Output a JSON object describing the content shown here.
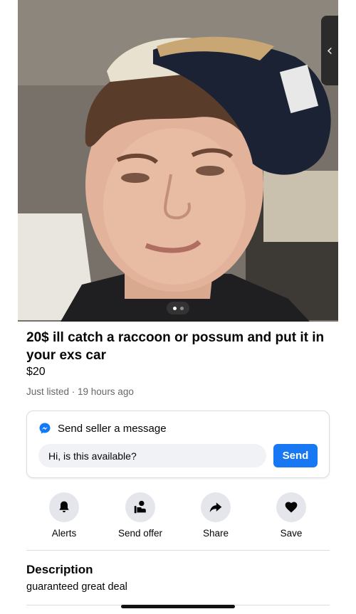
{
  "listing": {
    "title": "20$ ill catch a raccoon or possum and put it in your exs car",
    "price": "$20",
    "meta": "Just listed · 19 hours ago",
    "photo_count": 2,
    "active_photo": 1
  },
  "message": {
    "header": "Send seller a message",
    "input_value": "Hi, is this available?",
    "send_label": "Send"
  },
  "actions": [
    {
      "label": "Alerts",
      "icon": "bell-icon"
    },
    {
      "label": "Send offer",
      "icon": "offer-icon"
    },
    {
      "label": "Share",
      "icon": "share-icon"
    },
    {
      "label": "Save",
      "icon": "heart-icon"
    }
  ],
  "description": {
    "title": "Description",
    "text": "guaranteed great deal"
  },
  "colors": {
    "accent": "#1877f2",
    "icon_bg": "#e4e6eb",
    "secondary_text": "#65676b"
  }
}
